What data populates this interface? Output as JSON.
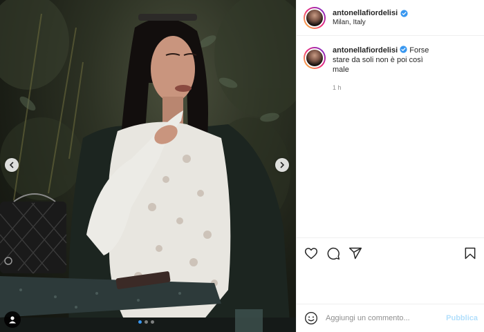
{
  "post": {
    "username": "antonellafiordelisi",
    "location": "Milan, Italy",
    "verified": true,
    "caption": "Forse stare da soli non è poi così male",
    "timestamp": "1 h"
  },
  "carousel": {
    "slide_count": 3,
    "active_index": 0,
    "prev_icon": "chevron-left-icon",
    "next_icon": "chevron-right-icon",
    "tag_icon": "user-tag-icon"
  },
  "actions": {
    "like_icon": "heart-icon",
    "comment_icon": "comment-icon",
    "share_icon": "paper-plane-icon",
    "save_icon": "bookmark-icon"
  },
  "comment_box": {
    "placeholder": "Aggiungi un commento...",
    "publish_label": "Pubblica",
    "emoji_icon": "smiley-icon"
  },
  "colors": {
    "verified_blue": "#3897f0",
    "publish_disabled": "#b2dffc",
    "meta_gray": "#8e8e8e"
  }
}
